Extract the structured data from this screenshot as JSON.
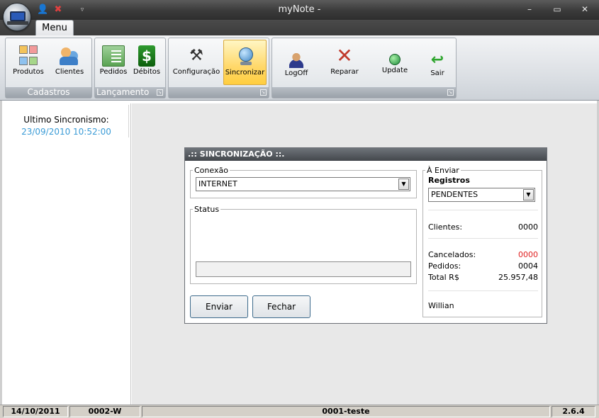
{
  "window": {
    "title": "myNote -",
    "controls": {
      "minimize": "–",
      "maximize": "▭",
      "close": "✕"
    }
  },
  "tabs": [
    {
      "label": "Menu"
    }
  ],
  "ribbon": {
    "groups": [
      {
        "label": "Cadastros",
        "buttons": [
          {
            "label": "Produtos",
            "icon": "products-icon"
          },
          {
            "label": "Clientes",
            "icon": "clients-icon"
          }
        ]
      },
      {
        "label": "Lançamento",
        "buttons": [
          {
            "label": "Pedidos",
            "icon": "orders-icon"
          },
          {
            "label": "Débitos",
            "icon": "debits-icon"
          }
        ]
      },
      {
        "label": "",
        "buttons": [
          {
            "label": "Configuração",
            "icon": "configuration-icon"
          },
          {
            "label": "Sincronizar",
            "icon": "sync-icon"
          }
        ]
      },
      {
        "label": "",
        "buttons": [
          {
            "label": "LogOff",
            "icon": "logoff-icon"
          },
          {
            "label": "Reparar",
            "icon": "repair-icon"
          },
          {
            "label": "Update",
            "icon": "update-icon"
          },
          {
            "label": "Sair",
            "icon": "exit-icon"
          }
        ]
      }
    ]
  },
  "left_panel": {
    "label": "Ultimo Sincronismo:",
    "value": "23/09/2010 10:52:00",
    "value_color": "#3a9bd6"
  },
  "dialog": {
    "title": ".:: SINCRONIZAÇÃO ::.",
    "conexao": {
      "legend": "Conexão",
      "selected": "INTERNET"
    },
    "status": {
      "legend": "Status"
    },
    "enviar_button": "Enviar",
    "fechar_button": "Fechar",
    "a_enviar": {
      "legend": "À Enviar",
      "registros_label": "Registros",
      "registros_selected": "PENDENTES",
      "clientes_label": "Clientes:",
      "clientes_value": "0000",
      "cancelados_label": "Cancelados:",
      "cancelados_value": "0000",
      "cancelados_color": "#e02020",
      "pedidos_label": "Pedidos:",
      "pedidos_value": "0004",
      "total_label": "Total R$",
      "total_value": "25.957,48",
      "user": "Willian"
    }
  },
  "status_bar": {
    "date": "14/10/2011",
    "code": "0002-W",
    "company": "0001-teste",
    "version": "2.6.4"
  }
}
